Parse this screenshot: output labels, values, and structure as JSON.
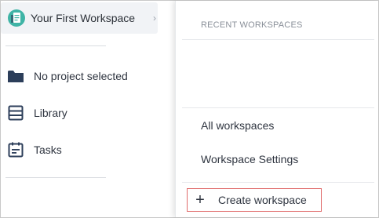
{
  "sidebar": {
    "workspace_title": "Your First Workspace",
    "items": [
      {
        "label": "No project selected",
        "icon": "folder-icon"
      },
      {
        "label": "Library",
        "icon": "library-icon"
      },
      {
        "label": "Tasks",
        "icon": "tasks-icon"
      }
    ]
  },
  "dropdown": {
    "recent_heading": "RECENT WORKSPACES",
    "all_workspaces": "All workspaces",
    "workspace_settings": "Workspace Settings",
    "create_workspace": "Create workspace"
  },
  "colors": {
    "highlight_border": "#e06b6b",
    "avatar_teal": "#3fb4a6",
    "icon_navy": "#2c3e5a"
  }
}
